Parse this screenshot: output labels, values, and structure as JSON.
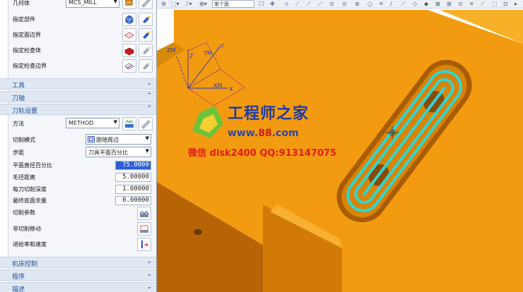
{
  "panel": {
    "geometry_label": "几何体",
    "geometry_value": "MCS_MILL",
    "specify_part": "指定部件",
    "specify_face_boundary": "指定面边界",
    "specify_check_body": "指定检查体",
    "specify_check_boundary": "指定检查边界",
    "sections": {
      "tool": "工具",
      "tool_axis": "刀轴",
      "path_settings": "刀轨设置",
      "machine_control": "机床控制",
      "program": "程序",
      "description": "描述"
    },
    "method_label": "方法",
    "method_value": "METHOD",
    "cut_pattern_label": "切削模式",
    "cut_pattern_value": "跟随周边",
    "stepover_label": "步距",
    "stepover_value": "刀具平面百分比",
    "flat_diameter_label": "平面直径百分比",
    "flat_diameter_value": "75.0000",
    "blank_distance_label": "毛坯距离",
    "blank_distance_value": "5.00000",
    "depth_per_cut_label": "每刀切削深度",
    "depth_per_cut_value": "1.00000",
    "final_floor_stock_label": "最终底面余量",
    "final_floor_stock_value": "0.00000",
    "cut_params_label": "切削参数",
    "non_cut_moves_label": "非切削移动",
    "feeds_speeds_label": "进给率和速度"
  },
  "toolbar": {
    "filter_value": "单个面"
  },
  "viewport": {
    "axes": {
      "zm": "ZM",
      "ym": "YM",
      "xm": "XM",
      "z": "Z",
      "y": "Y",
      "x": "X"
    },
    "watermark_title": "工程师之家",
    "watermark_url_prefix": "www.",
    "watermark_url_num": "88",
    "watermark_url_suffix": ".com",
    "watermark_contact": "微信 disk2400  QQ:913147075"
  },
  "colors": {
    "part_orange": "#f29a0c",
    "part_dark": "#c86f05",
    "toolpath": "#2fd6d6",
    "section_text": "#1e4f9a"
  }
}
